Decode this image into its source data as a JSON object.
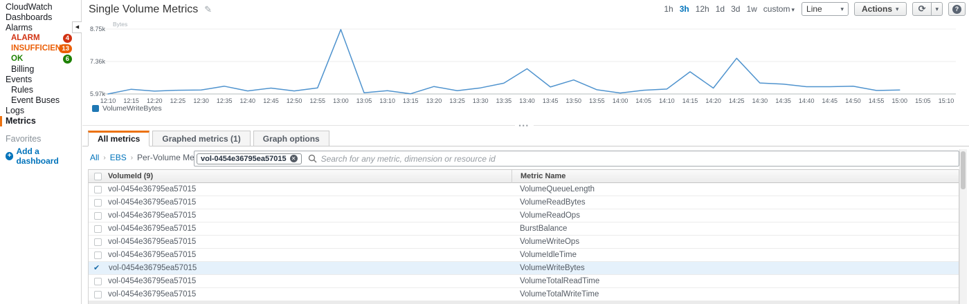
{
  "sidebar": {
    "items": [
      {
        "label": "CloudWatch",
        "cls": ""
      },
      {
        "label": "Dashboards",
        "cls": ""
      },
      {
        "label": "Alarms",
        "cls": ""
      },
      {
        "label": "ALARM",
        "cls": "sub c-red",
        "badge": "4",
        "badge_color": "#d13212"
      },
      {
        "label": "INSUFFICIENT",
        "cls": "sub c-orange",
        "badge": "13",
        "badge_color": "#eb5f07"
      },
      {
        "label": "OK",
        "cls": "sub c-green",
        "badge": "6",
        "badge_color": "#1d8102"
      },
      {
        "label": "Billing",
        "cls": "sub"
      },
      {
        "label": "Events",
        "cls": ""
      },
      {
        "label": "Rules",
        "cls": "sub"
      },
      {
        "label": "Event Buses",
        "cls": "sub"
      },
      {
        "label": "Logs",
        "cls": ""
      },
      {
        "label": "Metrics",
        "cls": "active"
      }
    ],
    "favorites_label": "Favorites",
    "add_dashboard_label": "Add a dashboard"
  },
  "header": {
    "title": "Single Volume Metrics",
    "time_ranges": [
      {
        "label": "1h"
      },
      {
        "label": "3h"
      },
      {
        "label": "12h"
      },
      {
        "label": "1d"
      },
      {
        "label": "3d"
      },
      {
        "label": "1w"
      },
      {
        "label": "custom",
        "caret": true
      }
    ],
    "selected_range": "3h",
    "chart_type_value": "Line",
    "actions_label": "Actions"
  },
  "chart_data": {
    "type": "line",
    "unit": "Bytes",
    "y_ticks": [
      {
        "label": "8.75k",
        "value": 8.75
      },
      {
        "label": "7.36k",
        "value": 7.36
      },
      {
        "label": "5.97k",
        "value": 5.97
      }
    ],
    "ylim_k": [
      5.97,
      8.9
    ],
    "x_axis_ticks": [
      "12:10",
      "12:15",
      "12:20",
      "12:25",
      "12:30",
      "12:35",
      "12:40",
      "12:45",
      "12:50",
      "12:55",
      "13:00",
      "13:05",
      "13:10",
      "13:15",
      "13:20",
      "13:25",
      "13:30",
      "13:35",
      "13:40",
      "13:45",
      "13:50",
      "13:55",
      "14:00",
      "14:05",
      "14:10",
      "14:15",
      "14:20",
      "14:25",
      "14:30",
      "14:35",
      "14:40",
      "14:45",
      "14:50",
      "14:55",
      "15:00",
      "15:05",
      "15:10"
    ],
    "x": [
      "12:10",
      "12:15",
      "12:20",
      "12:25",
      "12:30",
      "12:35",
      "12:40",
      "12:45",
      "12:50",
      "12:55",
      "13:00",
      "13:05",
      "13:10",
      "13:15",
      "13:20",
      "13:25",
      "13:30",
      "13:35",
      "13:40",
      "13:45",
      "13:50",
      "13:55",
      "14:00",
      "14:05",
      "14:10",
      "14:15",
      "14:20",
      "14:25",
      "14:30",
      "14:35",
      "14:40",
      "14:45",
      "14:50",
      "14:55",
      "15:00"
    ],
    "series": [
      {
        "name": "VolumeWriteBytes",
        "color": "#4f93ce",
        "legend_color": "#1f78b4",
        "values_k": [
          5.97,
          6.17,
          6.09,
          6.13,
          6.14,
          6.3,
          6.1,
          6.22,
          6.1,
          6.23,
          8.73,
          6.02,
          6.11,
          5.98,
          6.29,
          6.11,
          6.23,
          6.43,
          7.05,
          6.27,
          6.57,
          6.15,
          6.01,
          6.13,
          6.18,
          6.92,
          6.22,
          7.5,
          6.44,
          6.39,
          6.28,
          6.28,
          6.3,
          6.12,
          6.14
        ]
      }
    ],
    "grid": true,
    "legend_position": "bottom-left"
  },
  "panel": {
    "tabs": [
      {
        "label": "All metrics",
        "active": true
      },
      {
        "label": "Graphed metrics (1)",
        "active": false
      },
      {
        "label": "Graph options",
        "active": false
      }
    ],
    "breadcrumb": [
      "All",
      "EBS",
      "Per-Volume Metrics"
    ],
    "filter_token": "vol-0454e36795ea57015",
    "search_placeholder": "Search for any metric, dimension or resource id",
    "table": {
      "col1_header": "VolumeId  (9)",
      "col2_header": "Metric Name",
      "rows": [
        {
          "volume_id": "vol-0454e36795ea57015",
          "metric": "VolumeQueueLength",
          "checked": false
        },
        {
          "volume_id": "vol-0454e36795ea57015",
          "metric": "VolumeReadBytes",
          "checked": false
        },
        {
          "volume_id": "vol-0454e36795ea57015",
          "metric": "VolumeReadOps",
          "checked": false
        },
        {
          "volume_id": "vol-0454e36795ea57015",
          "metric": "BurstBalance",
          "checked": false
        },
        {
          "volume_id": "vol-0454e36795ea57015",
          "metric": "VolumeWriteOps",
          "checked": false
        },
        {
          "volume_id": "vol-0454e36795ea57015",
          "metric": "VolumeIdleTime",
          "checked": false
        },
        {
          "volume_id": "vol-0454e36795ea57015",
          "metric": "VolumeWriteBytes",
          "checked": true
        },
        {
          "volume_id": "vol-0454e36795ea57015",
          "metric": "VolumeTotalReadTime",
          "checked": false
        },
        {
          "volume_id": "vol-0454e36795ea57015",
          "metric": "VolumeTotalWriteTime",
          "checked": false
        }
      ]
    }
  },
  "colors": {
    "accent_orange": "#ec7211",
    "link_blue": "#0073bb",
    "alarm_red": "#d13212",
    "insufficient_orange": "#eb5f07",
    "ok_green": "#1d8102",
    "selected_row": "#e5f1fb"
  }
}
